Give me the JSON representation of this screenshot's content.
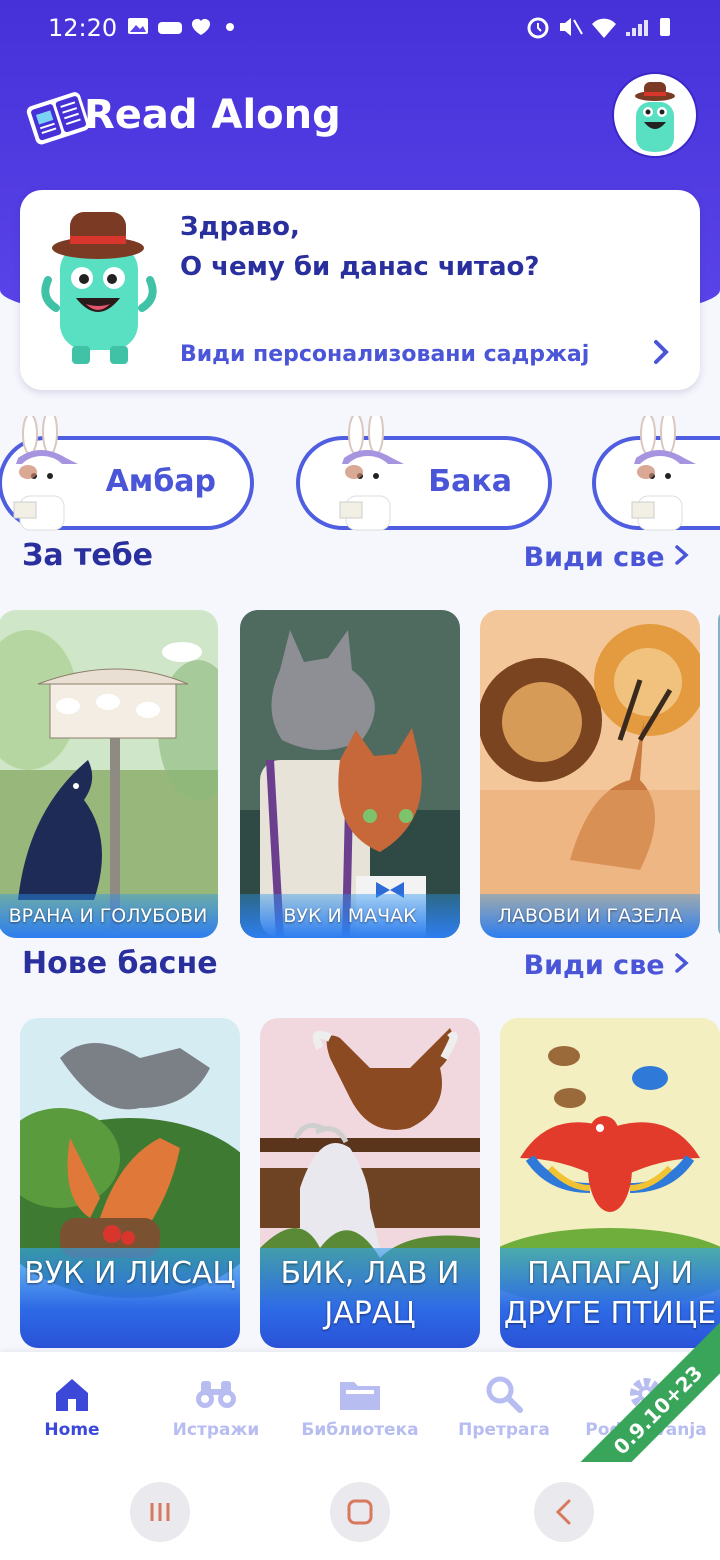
{
  "status_bar": {
    "time": "12:20",
    "left_icons": [
      "gallery-icon",
      "game-icon",
      "heart-icon",
      "dot-icon"
    ],
    "right_icons": [
      "alarm-icon",
      "mute-icon",
      "wifi-icon",
      "signal-icon",
      "battery-icon"
    ]
  },
  "header": {
    "app_title": "Read Along"
  },
  "greeting": {
    "line1": "Здраво,",
    "line2": "О чему би данас читао?",
    "link": "Види персонализовани садржај"
  },
  "profiles": [
    {
      "label": "Амбар"
    },
    {
      "label": "Бака"
    },
    {
      "label": ""
    }
  ],
  "sections": {
    "for_you": {
      "title": "За тебе",
      "see_all": "Види све",
      "books": [
        {
          "title": "ВРАНА И ГОЛУБОВИ"
        },
        {
          "title": "ВУК И МАЧАК"
        },
        {
          "title": "ЛАВОВИ И ГАЗЕЛА"
        }
      ]
    },
    "new_fables": {
      "title": "Нове басне",
      "see_all": "Види све",
      "books": [
        {
          "title": "ВУК И ЛИСАЦ"
        },
        {
          "title": "БИК, ЛАВ И ЈАРАЦ"
        },
        {
          "title": "ПАПАГАЈ И ДРУГЕ ПТИЦЕ"
        }
      ]
    }
  },
  "bottom_nav": [
    {
      "label": "Home",
      "icon": "home-icon",
      "active": true
    },
    {
      "label": "Истражи",
      "icon": "binoculars-icon",
      "active": false
    },
    {
      "label": "Библиотека",
      "icon": "library-icon",
      "active": false
    },
    {
      "label": "Претрага",
      "icon": "search-icon",
      "active": false
    },
    {
      "label": "Podešavanja",
      "icon": "settings-icon",
      "active": false
    }
  ],
  "version": "0.9.10+23",
  "colors": {
    "primary": "#4630d8",
    "accent": "#4a55d8",
    "nav_inactive": "#b7bdf0",
    "ribbon": "#39a55a"
  }
}
